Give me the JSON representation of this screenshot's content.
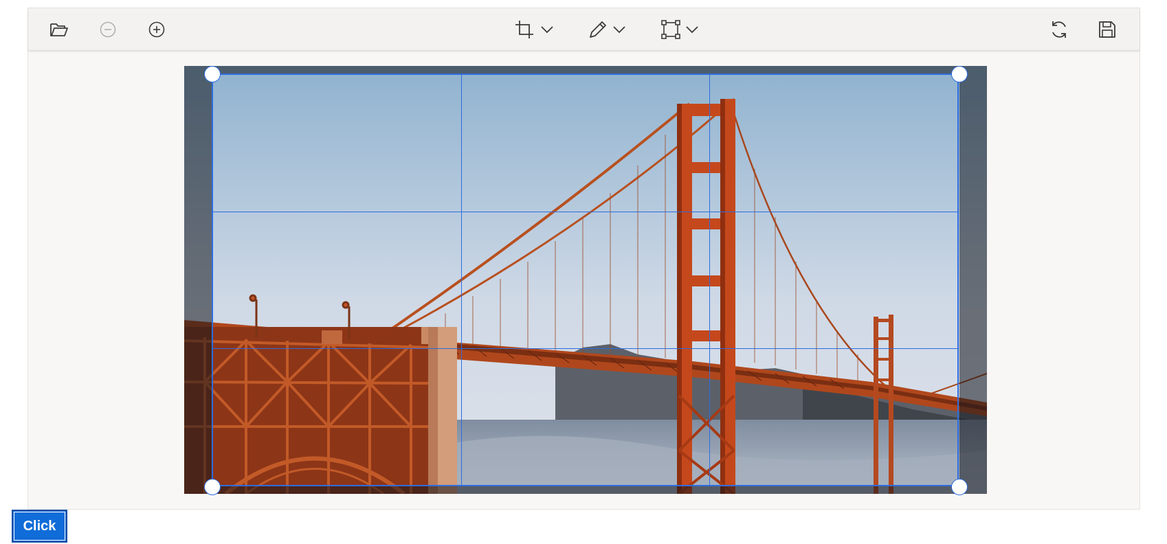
{
  "toolbar": {
    "left": [
      {
        "icon": "open-folder-icon",
        "enabled": true
      },
      {
        "icon": "zoom-out-icon",
        "enabled": false
      },
      {
        "icon": "zoom-in-icon",
        "enabled": true
      }
    ],
    "center": [
      {
        "icon": "crop-icon",
        "has_dropdown": true
      },
      {
        "icon": "pen-icon",
        "has_dropdown": true
      },
      {
        "icon": "transform-icon",
        "has_dropdown": true
      }
    ],
    "right": [
      {
        "icon": "reset-icon"
      },
      {
        "icon": "save-icon"
      }
    ]
  },
  "canvas": {
    "crop_grid": "rule-of-thirds",
    "accent_color": "#2d6cdf"
  },
  "footer": {
    "click_label": "Click"
  }
}
